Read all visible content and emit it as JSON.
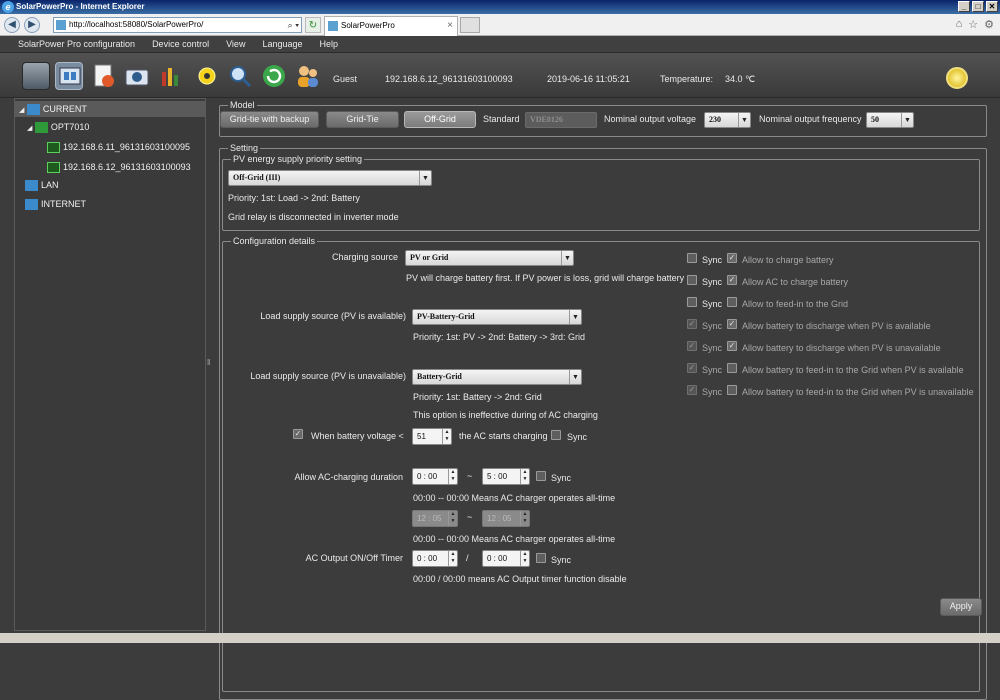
{
  "browser": {
    "title": "SolarPowerPro - Internet Explorer",
    "url": "http://localhost:58080/SolarPowerPro/",
    "tab_label": "SolarPowerPro"
  },
  "menu": [
    "SolarPower Pro configuration",
    "Device control",
    "View",
    "Language",
    "Help"
  ],
  "toolbar": {
    "icons": [
      "monitor-icon",
      "configuration-icon",
      "report-icon",
      "camera-icon",
      "data-log-icon",
      "solar-icon",
      "search-icon",
      "refresh-icon",
      "users-icon"
    ],
    "user": "Guest",
    "device": "192.168.6.12_96131603100093",
    "datetime": "2019-06-16 11:05:21",
    "temperature_label": "Temperature:",
    "temperature_value": "34.0 ℃"
  },
  "tree": {
    "current": "CURRENT",
    "opt": "OPT7010",
    "dev1": "192.168.6.11_96131603100095",
    "dev2": "192.168.6.12_96131603100093",
    "lan": "LAN",
    "internet": "INTERNET"
  },
  "model": {
    "legend": "Model",
    "buttons": [
      "Grid-tie with backup",
      "Grid-Tie",
      "Off-Grid"
    ],
    "selected": "Off-Grid",
    "standard_label": "Standard",
    "standard_value": "VDE0126",
    "voltage_label": "Nominal output voltage",
    "voltage_value": "230",
    "frequency_label": "Nominal output frequency",
    "frequency_value": "50"
  },
  "setting": {
    "legend": "Setting",
    "pv_legend": "PV energy supply priority setting",
    "pv_select": "Off-Grid (III)",
    "priority": "Priority: 1st: Load -> 2nd: Battery",
    "relay": "Grid relay is disconnected in inverter mode"
  },
  "config": {
    "legend": "Configuration details",
    "charging_label": "Charging source",
    "charging_value": "PV or Grid",
    "charging_note": "PV will charge battery first. If PV power is loss, grid will charge battery",
    "load_avail_label": "Load supply source (PV is available)",
    "load_avail_value": "PV-Battery-Grid",
    "load_avail_note": "Priority: 1st: PV -> 2nd: Battery -> 3rd: Grid",
    "load_unavail_label": "Load supply source (PV is unavailable)",
    "load_unavail_value": "Battery-Grid",
    "load_unavail_note1": "Priority: 1st: Battery -> 2nd: Grid",
    "load_unavail_note2": "This option is ineffective during of AC charging",
    "batt_label": "When battery voltage <",
    "batt_value": "51",
    "batt_after": "the AC starts charging",
    "sync": "Sync",
    "ac_dur_label": "Allow AC-charging duration",
    "ac_dur_start": "0 : 00",
    "ac_dur_end": "5 : 00",
    "tilde": "~",
    "ac_dur_note": "00:00 -- 00:00 Means AC charger operates all-time",
    "ac_dur2_start": "12 : 05",
    "ac_dur2_end": "12 : 05",
    "ac_dur2_note": "00:00 -- 00:00 Means AC charger operates all-time",
    "timer_label": "AC Output ON/Off Timer",
    "timer_on": "0 : 00",
    "timer_sep": "/",
    "timer_off": "0 : 00",
    "timer_note": "00:00 / 00:00 means AC Output timer function disable",
    "right_options": [
      {
        "sync_checked": false,
        "sync_dim": false,
        "opt_checked": true,
        "label": "Allow to charge battery"
      },
      {
        "sync_checked": false,
        "sync_dim": false,
        "opt_checked": true,
        "label": "Allow AC to charge battery"
      },
      {
        "sync_checked": false,
        "sync_dim": false,
        "opt_checked": false,
        "label": "Allow to feed-in to the Grid"
      },
      {
        "sync_checked": true,
        "sync_dim": true,
        "opt_checked": true,
        "label": "Allow battery to discharge when PV is available"
      },
      {
        "sync_checked": true,
        "sync_dim": true,
        "opt_checked": true,
        "label": "Allow battery to discharge when PV is unavailable"
      },
      {
        "sync_checked": true,
        "sync_dim": true,
        "opt_checked": false,
        "label": "Allow battery to feed-in to the Grid when PV is available"
      },
      {
        "sync_checked": true,
        "sync_dim": true,
        "opt_checked": false,
        "label": "Allow battery to feed-in to the Grid when PV is unavailable"
      }
    ],
    "apply": "Apply"
  }
}
